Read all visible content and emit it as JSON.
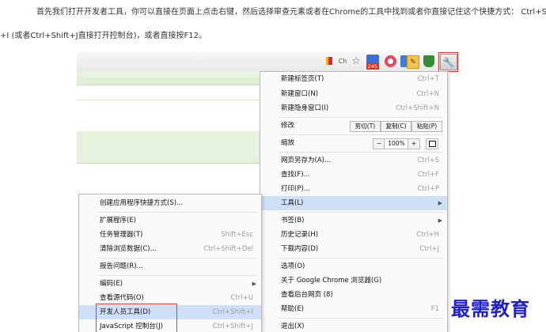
{
  "article": {
    "line1": "首先我们打开开发者工具，你可以直接在页面上点击右键，然后选择审查元素或者在Chrome的工具中找到或者你直接记住这个快捷方式：   Ctrl+Shif",
    "line2": "+I (或者Ctrl+Shift+J直接打开控制台)，或者直接按F12。"
  },
  "toolbar": {
    "icons": [
      "bookmark-icon",
      "translate-icon",
      "star-icon",
      "extension-245-icon",
      "extension-red-icon",
      "extension-blue-icon",
      "notes-icon",
      "shield-icon",
      "wrench-icon"
    ],
    "badge": "245"
  },
  "main_menu": {
    "items": [
      {
        "label": "新建标签页(T)",
        "shortcut": "Ctrl+T"
      },
      {
        "label": "新建窗口(N)",
        "shortcut": "Ctrl+N"
      },
      {
        "label": "新建隐身窗口(I)",
        "shortcut": "Ctrl+Shift+N"
      },
      {
        "label": "修改",
        "buttons": [
          "剪切(T)",
          "复制(C)",
          "粘贴(P)"
        ]
      },
      {
        "label": "缩放",
        "zoom": {
          "minus": "−",
          "value": "100%",
          "plus": "+"
        }
      },
      {
        "label": "网页另存为(A)...",
        "shortcut": "Ctrl+S"
      },
      {
        "label": "查找(F)...",
        "shortcut": "Ctrl+F"
      },
      {
        "label": "打印(P)...",
        "shortcut": "Ctrl+P"
      },
      {
        "label": "工具(L)"
      },
      {
        "label": "书签(B)"
      },
      {
        "label": "历史记录(H)",
        "shortcut": "Ctrl+H"
      },
      {
        "label": "下载内容(D)",
        "shortcut": "Ctrl+J"
      },
      {
        "label": "选项(O)"
      },
      {
        "label": "关于 Google Chrome 浏览器(G)"
      },
      {
        "label": "查看后台网页 (8)"
      },
      {
        "label": "帮助(E)",
        "shortcut": "F1"
      },
      {
        "label": "退出(X)"
      }
    ]
  },
  "tools_submenu": {
    "items": [
      {
        "label": "创建应用程序快捷方式(S)..."
      },
      {
        "label": "扩展程序(E)"
      },
      {
        "label": "任务管理器(T)",
        "shortcut": "Shift+Esc"
      },
      {
        "label": "清除浏览数据(C)...",
        "shortcut": "Ctrl+Shift+Del"
      },
      {
        "label": "报告问题(R)..."
      },
      {
        "label": "编码(E)"
      },
      {
        "label": "查看源代码(O)",
        "shortcut": "Ctrl+U"
      },
      {
        "label": "开发人员工具(D)",
        "shortcut": "Ctrl+Shift+I"
      },
      {
        "label": "JavaScript 控制台(J)",
        "shortcut": "Ctrl+Shift+J"
      }
    ]
  },
  "watermark": "最需教育",
  "colors": {
    "highlight": "#cfe0f6",
    "annotation_red": "#e53935",
    "watermark": "#1d1ed6"
  }
}
